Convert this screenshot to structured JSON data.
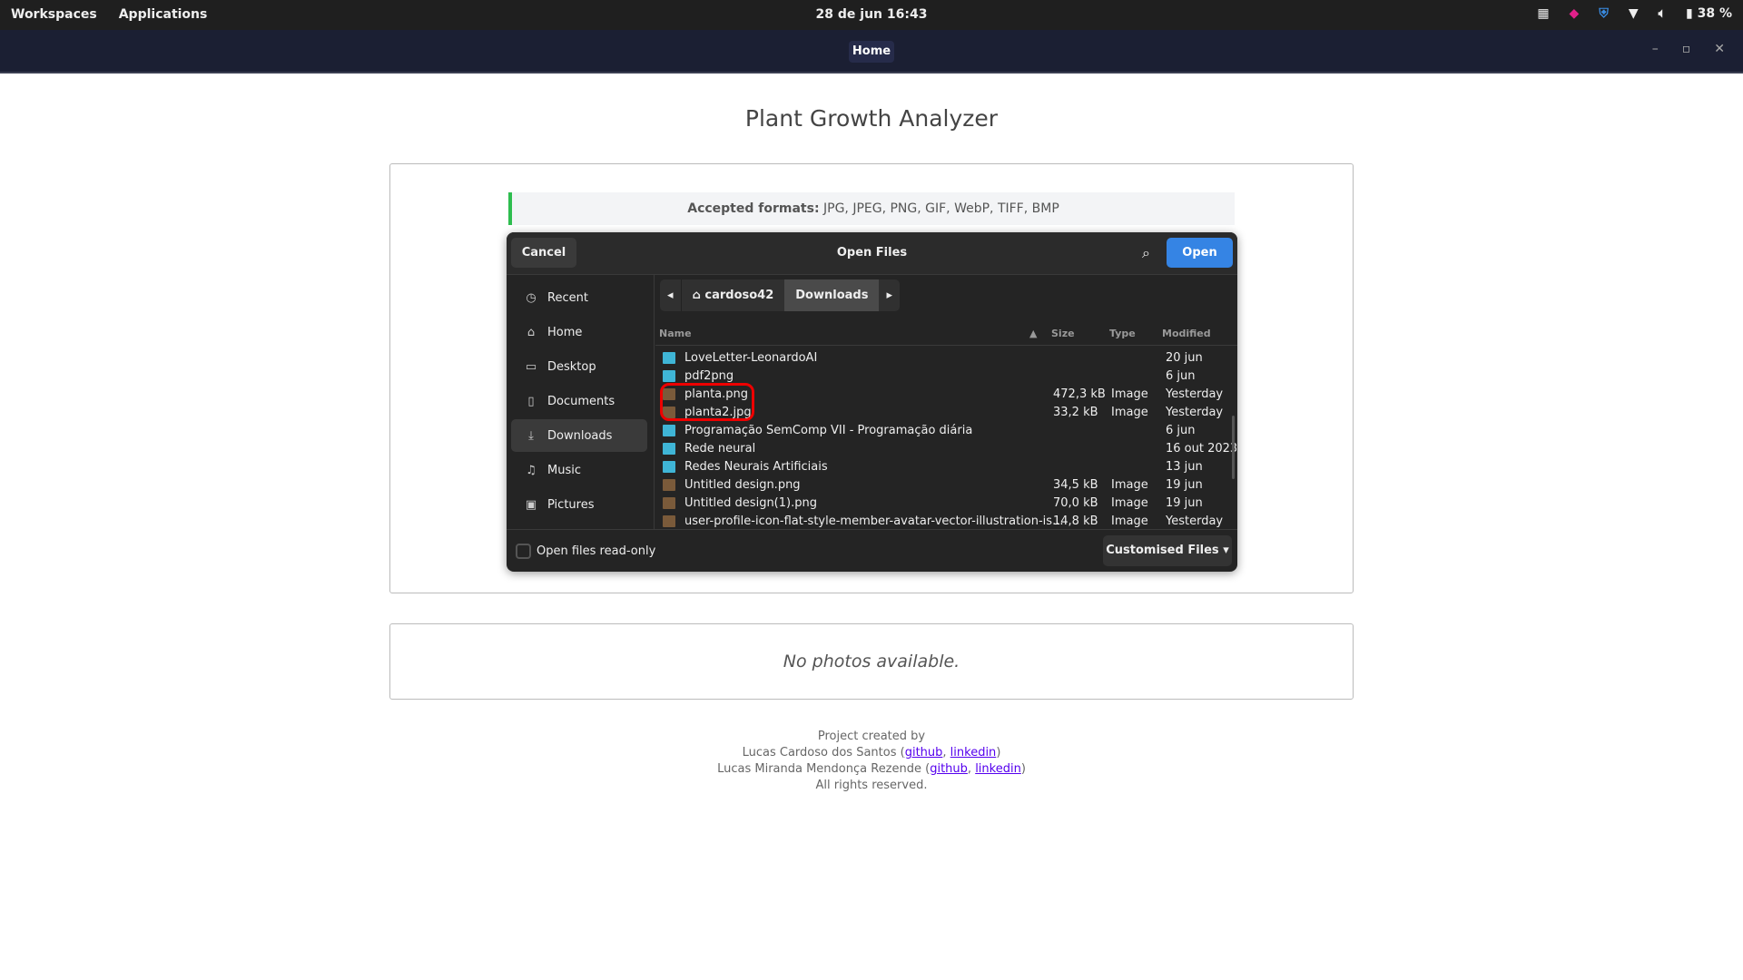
{
  "topbar": {
    "workspaces": "Workspaces",
    "applications": "Applications",
    "clock": "28 de jun  16:43",
    "battery": "38 %"
  },
  "window": {
    "tab": "Home"
  },
  "page": {
    "title": "Plant Growth Analyzer",
    "formats_label": "Accepted formats:",
    "formats_value": " JPG, JPEG, PNG, GIF, WebP, TIFF, BMP",
    "no_photos": "No photos available."
  },
  "dialog": {
    "cancel": "Cancel",
    "title": "Open Files",
    "open": "Open",
    "sidebar": [
      {
        "label": "Recent",
        "icon": "clock-icon"
      },
      {
        "label": "Home",
        "icon": "home-icon"
      },
      {
        "label": "Desktop",
        "icon": "desktop-icon"
      },
      {
        "label": "Documents",
        "icon": "document-icon"
      },
      {
        "label": "Downloads",
        "icon": "download-icon",
        "selected": true
      },
      {
        "label": "Music",
        "icon": "music-icon"
      },
      {
        "label": "Pictures",
        "icon": "pictures-icon"
      }
    ],
    "path": [
      "cardoso42",
      "Downloads"
    ],
    "columns": {
      "name": "Name",
      "size": "Size",
      "type": "Type",
      "modified": "Modified"
    },
    "files": [
      {
        "name": "LoveLetter-LeonardoAI",
        "size": "",
        "type": "",
        "modified": "20 jun",
        "kind": "folder"
      },
      {
        "name": "pdf2png",
        "size": "",
        "type": "",
        "modified": "6 jun",
        "kind": "folder"
      },
      {
        "name": "planta.png",
        "size": "472,3 kB",
        "type": "Image",
        "modified": "Yesterday",
        "kind": "image"
      },
      {
        "name": "planta2.jpg",
        "size": "33,2 kB",
        "type": "Image",
        "modified": "Yesterday",
        "kind": "image"
      },
      {
        "name": "Programação SemComp VII - Programação diária",
        "size": "",
        "type": "",
        "modified": "6 jun",
        "kind": "folder"
      },
      {
        "name": "Rede neural",
        "size": "",
        "type": "",
        "modified": "16 out 2023",
        "kind": "folder"
      },
      {
        "name": "Redes Neurais Artificiais",
        "size": "",
        "type": "",
        "modified": "13 jun",
        "kind": "folder"
      },
      {
        "name": "Untitled design.png",
        "size": "34,5 kB",
        "type": "Image",
        "modified": "19 jun",
        "kind": "image"
      },
      {
        "name": "Untitled design(1).png",
        "size": "70,0 kB",
        "type": "Image",
        "modified": "19 jun",
        "kind": "image"
      },
      {
        "name": "user-profile-icon-flat-style-member-avatar-vector-illustration-is...",
        "size": "14,8 kB",
        "type": "Image",
        "modified": "Yesterday",
        "kind": "image"
      }
    ],
    "readonly": "Open files read-only",
    "filter": "Customised Files"
  },
  "credits": {
    "line1": "Project created by",
    "author1": "Lucas Cardoso dos Santos",
    "author2": "Lucas Miranda Mendonça Rezende",
    "github": "github",
    "linkedin": "linkedin",
    "rights": "All rights reserved."
  }
}
